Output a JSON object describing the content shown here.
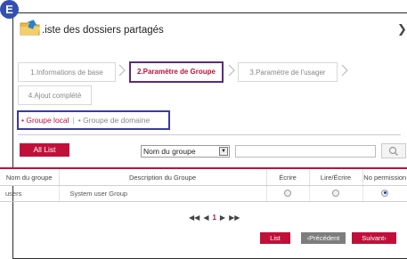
{
  "badge": "E",
  "title": ".iste des dossiers partagés",
  "steps": [
    {
      "label": "1.Informations de base",
      "active": false
    },
    {
      "label": "2.Paramètre de Groupe",
      "active": true
    },
    {
      "label": "3.Paramètre de l'usager",
      "active": false
    },
    {
      "label": "4.Ajout complété",
      "active": false
    }
  ],
  "group_filter": {
    "local": "• Groupe local",
    "separator": "|",
    "domain": "• Groupe de domaine"
  },
  "toolbar": {
    "all_list": "All List",
    "select_value": "Nom du groupe"
  },
  "table": {
    "headers": [
      "Nom du groupe",
      "Description du Groupe",
      "Écrire",
      "Lire/Écrire",
      "No permission"
    ],
    "rows": [
      {
        "name": "users",
        "description": "System user Group",
        "permission": "No permission"
      }
    ]
  },
  "pager": {
    "first": "◀◀",
    "prev": "◀",
    "page": "1",
    "next": "▶",
    "last": "▶▶"
  },
  "buttons": {
    "list": "List",
    "prev": "‹Précédent",
    "next": "Suivant›"
  },
  "colors": {
    "accent": "#c0103a",
    "active_tab_border": "#5c2a7e",
    "highlight_box": "#3a3aa0",
    "badge": "#3350b0"
  }
}
